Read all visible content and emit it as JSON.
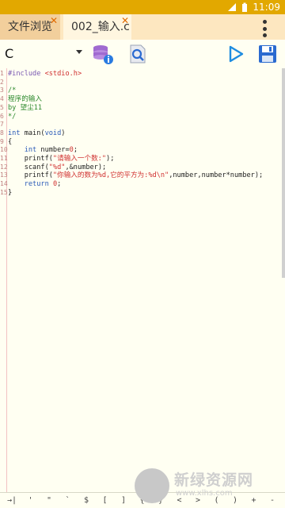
{
  "status_bar": {
    "time": "11:09"
  },
  "tabs": [
    {
      "label": "文件浏览",
      "active": false
    },
    {
      "label": "002_输入.c",
      "active": true
    }
  ],
  "toolbar": {
    "language": "C",
    "icons": [
      "database-info-icon",
      "search-file-icon",
      "run-icon",
      "save-icon"
    ]
  },
  "code_lines": [
    {
      "n": "1",
      "parts": [
        [
          "pre",
          "#include "
        ],
        [
          "str",
          "<stdio.h>"
        ]
      ]
    },
    {
      "n": "2",
      "parts": []
    },
    {
      "n": "3",
      "parts": [
        [
          "cm",
          "/*"
        ]
      ]
    },
    {
      "n": "4",
      "parts": [
        [
          "cm",
          "程序的输入"
        ]
      ]
    },
    {
      "n": "5",
      "parts": [
        [
          "cm",
          "by 望尘11"
        ]
      ]
    },
    {
      "n": "6",
      "parts": [
        [
          "cm",
          "*/"
        ]
      ]
    },
    {
      "n": "7",
      "parts": []
    },
    {
      "n": "8",
      "parts": [
        [
          "kw",
          "int"
        ],
        [
          "txt",
          " main("
        ],
        [
          "kw",
          "void"
        ],
        [
          "txt",
          ")"
        ]
      ]
    },
    {
      "n": "9",
      "parts": [
        [
          "txt",
          "{"
        ]
      ]
    },
    {
      "n": "10",
      "parts": [
        [
          "txt",
          "    "
        ],
        [
          "kw",
          "int"
        ],
        [
          "txt",
          " number="
        ],
        [
          "num",
          "0"
        ],
        [
          "txt",
          ";"
        ]
      ]
    },
    {
      "n": "11",
      "parts": [
        [
          "txt",
          "    printf("
        ],
        [
          "str",
          "\"请输入一个数:\""
        ],
        [
          "txt",
          ");"
        ]
      ]
    },
    {
      "n": "12",
      "parts": [
        [
          "txt",
          "    scanf("
        ],
        [
          "str",
          "\"%d\""
        ],
        [
          "txt",
          ",&number);"
        ]
      ]
    },
    {
      "n": "13",
      "parts": [
        [
          "txt",
          "    printf("
        ],
        [
          "str",
          "\"你输入的数为%d,它的平方为:%d\\n\""
        ],
        [
          "txt",
          ",number,number*number);"
        ]
      ]
    },
    {
      "n": "14",
      "parts": [
        [
          "txt",
          "    "
        ],
        [
          "kw",
          "return"
        ],
        [
          "txt",
          " "
        ],
        [
          "num",
          "0"
        ],
        [
          "txt",
          ";"
        ]
      ]
    },
    {
      "n": "15",
      "parts": [
        [
          "txt",
          "}"
        ]
      ]
    }
  ],
  "symbol_keys": [
    "→|",
    "'",
    "\"",
    "`",
    "$",
    "[",
    "]",
    "{",
    "}",
    "<",
    ">",
    "(",
    ")",
    "+",
    "-"
  ],
  "watermark": {
    "title": "新绿资源网",
    "url": "www.xlhs.com"
  },
  "colors": {
    "status_bar": "#e2a800",
    "tab_bar": "#fde7c0",
    "editor_bg": "#fffff2",
    "accent": "#e16a00"
  }
}
